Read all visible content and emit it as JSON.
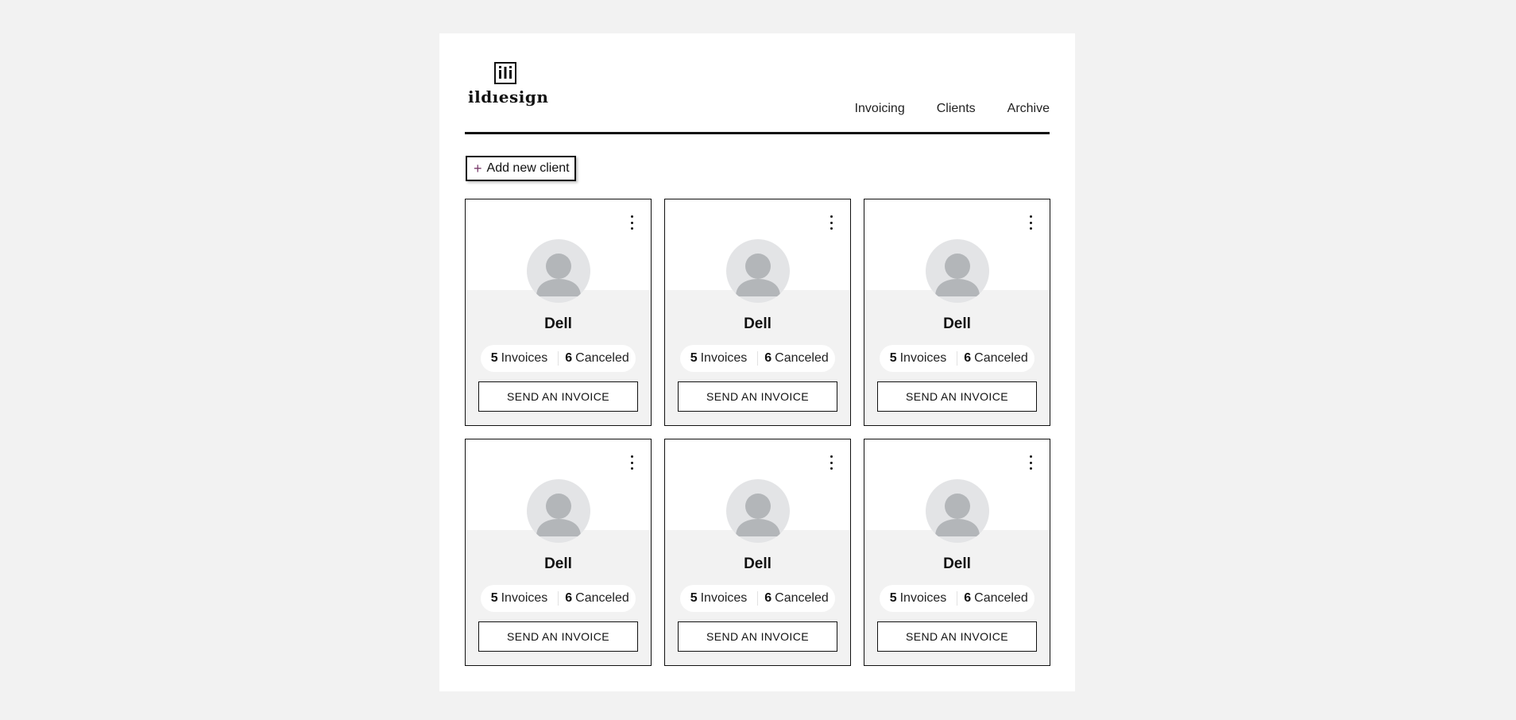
{
  "brand": {
    "logo_mark": "ili",
    "logo_text": "ildıesign"
  },
  "nav": [
    {
      "label": "Invoicing"
    },
    {
      "label": "Clients"
    },
    {
      "label": "Archive"
    }
  ],
  "actions": {
    "add_client_label": "Add new client"
  },
  "clients": [
    {
      "name": "Dell",
      "invoices": {
        "count": "5",
        "label": "Invoices"
      },
      "canceled": {
        "count": "6",
        "label": "Canceled"
      },
      "send_label": "SEND AN INVOICE"
    },
    {
      "name": "Dell",
      "invoices": {
        "count": "5",
        "label": "Invoices"
      },
      "canceled": {
        "count": "6",
        "label": "Canceled"
      },
      "send_label": "SEND AN INVOICE"
    },
    {
      "name": "Dell",
      "invoices": {
        "count": "5",
        "label": "Invoices"
      },
      "canceled": {
        "count": "6",
        "label": "Canceled"
      },
      "send_label": "SEND AN INVOICE"
    },
    {
      "name": "Dell",
      "invoices": {
        "count": "5",
        "label": "Invoices"
      },
      "canceled": {
        "count": "6",
        "label": "Canceled"
      },
      "send_label": "SEND AN INVOICE"
    },
    {
      "name": "Dell",
      "invoices": {
        "count": "5",
        "label": "Invoices"
      },
      "canceled": {
        "count": "6",
        "label": "Canceled"
      },
      "send_label": "SEND AN INVOICE"
    },
    {
      "name": "Dell",
      "invoices": {
        "count": "5",
        "label": "Invoices"
      },
      "canceled": {
        "count": "6",
        "label": "Canceled"
      },
      "send_label": "SEND AN INVOICE"
    }
  ],
  "icons": {
    "add": "plus-icon",
    "card_menu": "kebab-menu-icon",
    "avatar": "user-avatar-icon"
  },
  "colors": {
    "page_bg": "#f2f2f2",
    "panel_bg": "#ffffff",
    "accent_plus": "#7a3b6b",
    "avatar_bg": "#e3e4e6",
    "avatar_fg": "#b3b6b9"
  }
}
